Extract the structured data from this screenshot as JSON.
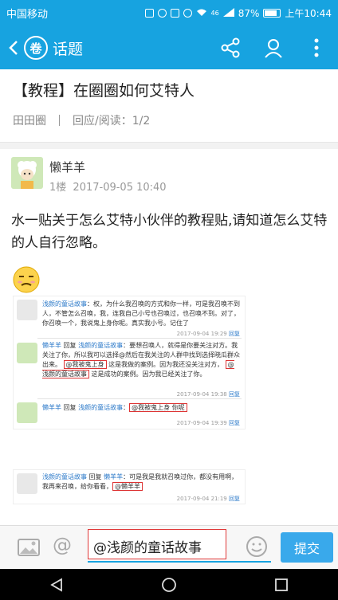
{
  "status": {
    "carrier": "中国移动",
    "signal_text": "46",
    "battery": "87%",
    "time": "上午10:44"
  },
  "appbar": {
    "logo_text": "卷",
    "title": "话题"
  },
  "thread": {
    "title": "【教程】在圈圈如何艾特人",
    "circle": "田田圈",
    "stats": "回应/阅读：1/2"
  },
  "post": {
    "author": "懒羊羊",
    "floor": "1楼",
    "time": "2017-09-05 10:40",
    "content": "水一贴关于怎么艾特小伙伴的教程贴,请知道怎么艾特的人自行忽略。"
  },
  "screenshot1": {
    "r1_name": "浅颜的童话故事",
    "r1_text": "：权，为什么我召唤的方式和你一样，可是我召唤不到人，不管怎么召唤，我，连我自己小号也召唤过，也召唤不到。对了，你召唤一个，我说鬼上身你呢。真实我小号。记住了",
    "r1_time": "2017-09-04 19:29",
    "r1_reply": "回复",
    "r2_name": "懒羊羊",
    "r2_mid": "回复",
    "r2_target": "浅颜的童话故事",
    "r2_text": "：要想召唤人，就得是你要关注对方。我关注了你，所以我可以选择@然后在我关注的人群中找到选择晓瓜群众出来。",
    "r2_hl1": "@我被鬼上身",
    "r2_text2": "这是我做的案例。因为我还没关注对方，",
    "r2_hl2": "@浅颜的童话故事",
    "r2_text3": "这是成功的案例。因为我已经关注了你。",
    "r2_time": "2017-09-04 19:38",
    "r2_reply": "回复",
    "r3_name": "懒羊羊",
    "r3_mid": "回复",
    "r3_target": "浅颜的童话故事",
    "r3_hl": "@我被鬼上身 你呢",
    "r3_time": "2017-09-04 19:39",
    "r3_reply": "回复"
  },
  "screenshot2": {
    "name": "浅颜的童话故事",
    "mid": "回复",
    "target": "懒羊羊",
    "text": "：可是我是我就召唤过你，都没有用啊，我再来召唤，给你看看，",
    "hl": "@懒羊羊",
    "time": "2017-09-04 21:19",
    "reply": "回复"
  },
  "composer": {
    "input_value": "@浅颜的童话故事",
    "submit_label": "提交"
  }
}
